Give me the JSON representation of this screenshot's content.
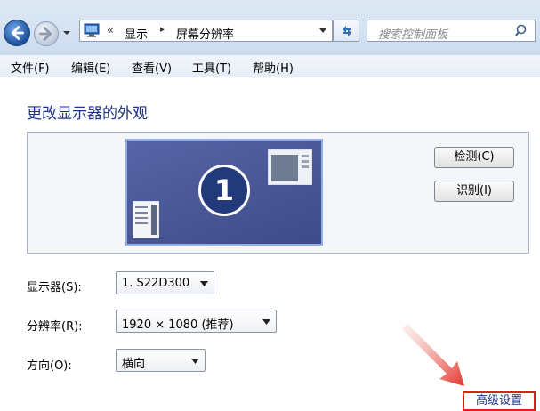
{
  "breadcrumb": {
    "prefix": "«",
    "items": [
      "显示",
      "屏幕分辨率"
    ],
    "separator": "▸"
  },
  "search": {
    "placeholder": "搜索控制面板"
  },
  "menu": [
    "文件(F)",
    "编辑(E)",
    "查看(V)",
    "工具(T)",
    "帮助(H)"
  ],
  "page_title": "更改显示器的外观",
  "monitor": {
    "number": "1"
  },
  "buttons": {
    "detect": "检测(C)",
    "identify": "识别(I)"
  },
  "fields": {
    "display": {
      "label": "显示器(S):",
      "value": "1. S22D300"
    },
    "resolution": {
      "label": "分辨率(R):",
      "value": "1920 × 1080 (推荐)"
    },
    "orientation": {
      "label": "方向(O):",
      "value": "横向"
    }
  },
  "advanced_link": "高级设置",
  "colors": {
    "accent": "#1e3287",
    "highlight": "#d9231a",
    "monitor": "#4b58a0"
  },
  "icons": [
    "back-arrow-icon",
    "forward-arrow-icon",
    "control-panel-icon",
    "refresh-icon",
    "search-icon",
    "dropdown-arrow-icon"
  ]
}
